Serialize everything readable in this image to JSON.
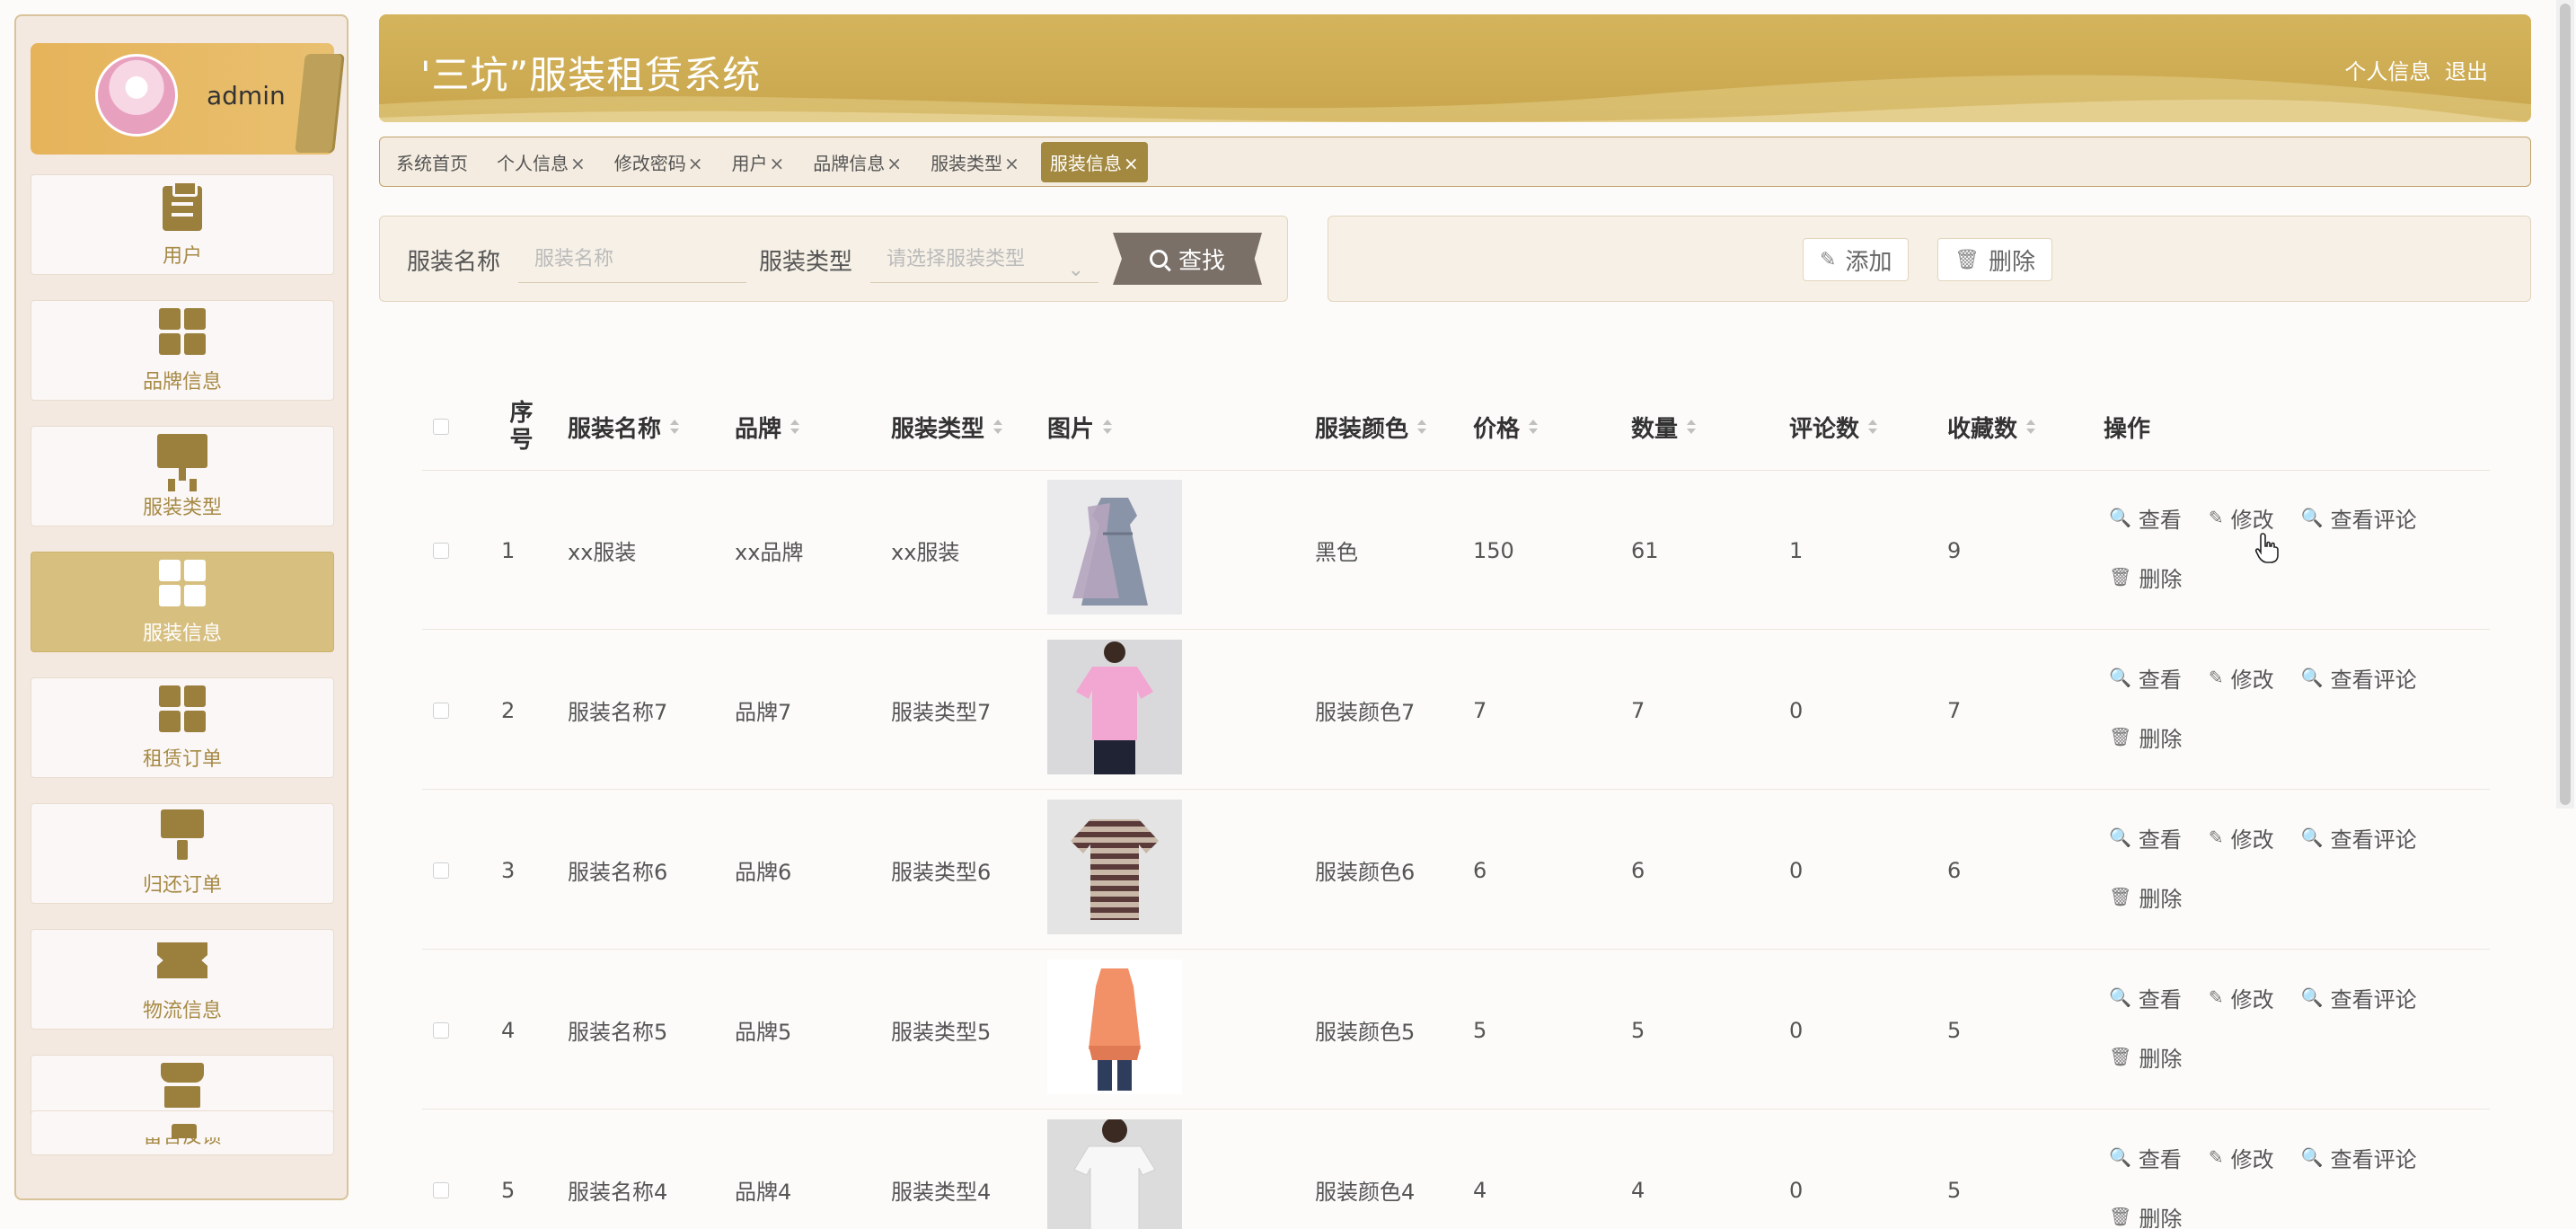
{
  "sidebar": {
    "profile_name": "admin",
    "items": [
      {
        "label": "用户",
        "icon": "clipboard-icon",
        "active": false
      },
      {
        "label": "品牌信息",
        "icon": "grid-icon",
        "active": false
      },
      {
        "label": "服装类型",
        "icon": "monitor-icon",
        "active": false
      },
      {
        "label": "服装信息",
        "icon": "grid-icon",
        "active": true
      },
      {
        "label": "租赁订单",
        "icon": "grid-icon",
        "active": false
      },
      {
        "label": "归还订单",
        "icon": "brush-icon",
        "active": false
      },
      {
        "label": "物流信息",
        "icon": "ticket-icon",
        "active": false
      },
      {
        "label": "留言反馈",
        "icon": "store-icon",
        "active": false
      }
    ]
  },
  "header": {
    "title": "'三坑”服装租赁系统",
    "link_profile": "个人信息",
    "link_logout": "退出"
  },
  "tabs": [
    {
      "label": "系统首页",
      "closable": false
    },
    {
      "label": "个人信息",
      "closable": true
    },
    {
      "label": "修改密码",
      "closable": true
    },
    {
      "label": "用户",
      "closable": true
    },
    {
      "label": "品牌信息",
      "closable": true
    },
    {
      "label": "服装类型",
      "closable": true
    },
    {
      "label": "服装信息",
      "closable": true,
      "active": true
    }
  ],
  "tab_close_glyph": "×",
  "search": {
    "name_label": "服装名称",
    "name_placeholder": "服装名称",
    "type_label": "服装类型",
    "type_placeholder": "请选择服装类型",
    "button": "查找"
  },
  "actions": {
    "add": "添加",
    "delete": "删除"
  },
  "table": {
    "columns": [
      "序号",
      "服装名称",
      "品牌",
      "服装类型",
      "图片",
      "服装颜色",
      "价格",
      "数量",
      "评论数",
      "收藏数",
      "操作"
    ],
    "rows": [
      {
        "index": "1",
        "name": "xx服装",
        "brand": "xx品牌",
        "type": "xx服装",
        "color": "黑色",
        "price": "150",
        "qty": "61",
        "comments": "1",
        "favorites": "9",
        "image": "dress"
      },
      {
        "index": "2",
        "name": "服装名称7",
        "brand": "品牌7",
        "type": "服装类型7",
        "color": "服装颜色7",
        "price": "7",
        "qty": "7",
        "comments": "0",
        "favorites": "7",
        "image": "pink-tee"
      },
      {
        "index": "3",
        "name": "服装名称6",
        "brand": "品牌6",
        "type": "服装类型6",
        "color": "服装颜色6",
        "price": "6",
        "qty": "6",
        "comments": "0",
        "favorites": "6",
        "image": "striped-tee"
      },
      {
        "index": "4",
        "name": "服装名称5",
        "brand": "品牌5",
        "type": "服装类型5",
        "color": "服装颜色5",
        "price": "5",
        "qty": "5",
        "comments": "0",
        "favorites": "5",
        "image": "orange-top"
      },
      {
        "index": "5",
        "name": "服装名称4",
        "brand": "品牌4",
        "type": "服装类型4",
        "color": "服装颜色4",
        "price": "4",
        "qty": "4",
        "comments": "0",
        "favorites": "5",
        "image": "white-tee"
      }
    ],
    "row_actions": {
      "view": "查看",
      "edit": "修改",
      "view_comments": "查看评论",
      "delete": "删除"
    }
  },
  "colors": {
    "accent": "#c9a64d",
    "menu_active": "#d7bf80",
    "icon": "#9a7f3d"
  }
}
